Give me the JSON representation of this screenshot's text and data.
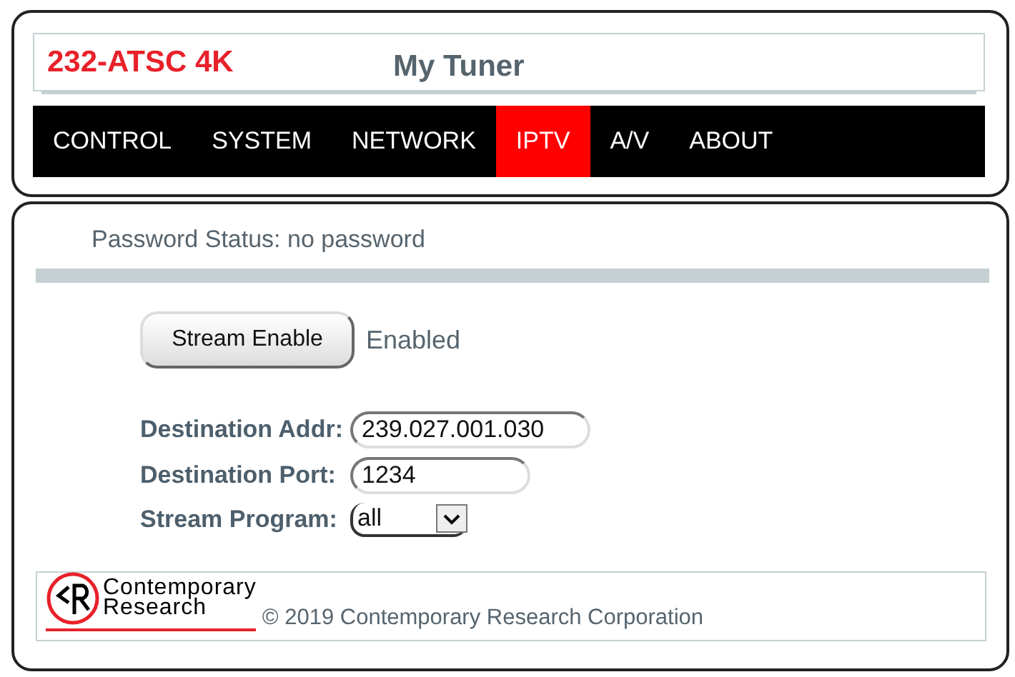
{
  "header": {
    "model": "232-ATSC 4K",
    "device_name": "My Tuner"
  },
  "nav": [
    {
      "label": "CONTROL",
      "selected": false
    },
    {
      "label": "SYSTEM",
      "selected": false
    },
    {
      "label": "NETWORK",
      "selected": false
    },
    {
      "label": "IPTV",
      "selected": true
    },
    {
      "label": "A/V",
      "selected": false
    },
    {
      "label": "ABOUT",
      "selected": false
    }
  ],
  "password_status": "Password Status: no password",
  "stream": {
    "button": "Stream Enable",
    "status": "Enabled"
  },
  "fields": [
    {
      "kind": "text",
      "label": "Destination Addr:",
      "value": "239.027.001.030"
    },
    {
      "kind": "text",
      "label": "Destination Port:",
      "value": "1234"
    },
    {
      "kind": "select",
      "label": "Stream Program:",
      "value": "all"
    }
  ],
  "footer": {
    "logo_lines": [
      "Contemporary",
      "Research"
    ],
    "copyright": "© 2019 Contemporary Research Corporation"
  }
}
